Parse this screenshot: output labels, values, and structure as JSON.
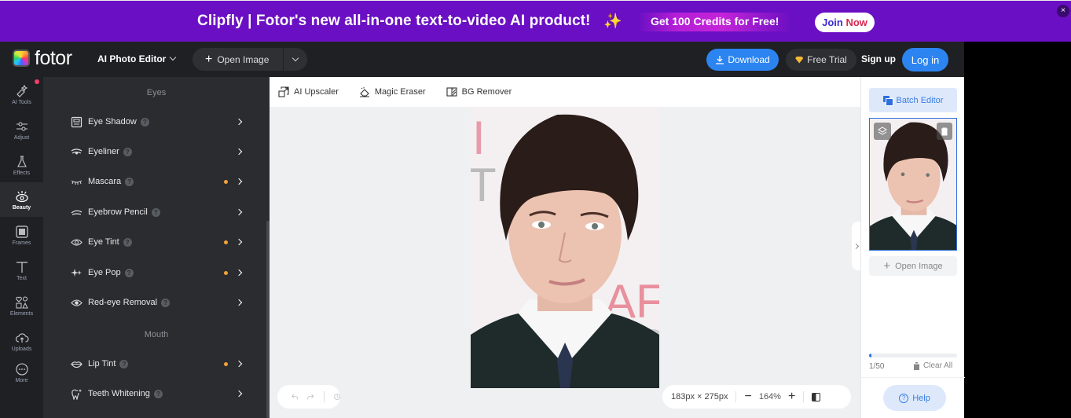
{
  "banner": {
    "title": "Clipfly | Fotor's new all-in-one text-to-video AI product!",
    "sparkle_icon": "sparkle-icon",
    "promo": "Get 100 Credits for Free!",
    "join_label_1": "Join",
    "join_label_2": "Now",
    "close_glyph": "×"
  },
  "topbar": {
    "logo_text": "fotor",
    "editor_mode": "AI Photo Editor",
    "open_image": "Open Image",
    "download": "Download",
    "free_trial": "Free Trial",
    "sign_up": "Sign up",
    "log_in": "Log in"
  },
  "rail": {
    "items": [
      {
        "label": "AI Tools",
        "icon": "ai-tools-icon"
      },
      {
        "label": "Adjust",
        "icon": "adjust-icon"
      },
      {
        "label": "Effects",
        "icon": "effects-icon"
      },
      {
        "label": "Beauty",
        "icon": "beauty-icon",
        "active": true
      },
      {
        "label": "Frames",
        "icon": "frames-icon"
      },
      {
        "label": "Text",
        "icon": "text-icon"
      },
      {
        "label": "Elements",
        "icon": "elements-icon"
      },
      {
        "label": "Uploads",
        "icon": "uploads-icon"
      },
      {
        "label": "More",
        "icon": "more-icon"
      }
    ]
  },
  "panel": {
    "sections": [
      {
        "title": "Eyes",
        "tools": [
          {
            "label": "Eye Shadow",
            "icon": "eye-shadow-icon",
            "pro": false
          },
          {
            "label": "Eyeliner",
            "icon": "eyeliner-icon",
            "pro": false
          },
          {
            "label": "Mascara",
            "icon": "mascara-icon",
            "pro": true
          },
          {
            "label": "Eyebrow Pencil",
            "icon": "eyebrow-pencil-icon",
            "pro": false
          },
          {
            "label": "Eye Tint",
            "icon": "eye-tint-icon",
            "pro": true
          },
          {
            "label": "Eye Pop",
            "icon": "eye-pop-icon",
            "pro": true
          },
          {
            "label": "Red-eye Removal",
            "icon": "red-eye-removal-icon",
            "pro": false
          }
        ]
      },
      {
        "title": "Mouth",
        "tools": [
          {
            "label": "Lip Tint",
            "icon": "lip-tint-icon",
            "pro": true
          },
          {
            "label": "Teeth Whitening",
            "icon": "teeth-whitening-icon",
            "pro": false
          }
        ]
      }
    ]
  },
  "canvas": {
    "toolbar": [
      {
        "label": "AI Upscaler",
        "icon": "upscale-icon"
      },
      {
        "label": "Magic Eraser",
        "icon": "eraser-icon"
      },
      {
        "label": "BG Remover",
        "icon": "bg-remover-icon"
      }
    ],
    "dimensions": "183px × 275px",
    "zoom_level": "164%",
    "zoom_minus": "−",
    "zoom_plus": "+"
  },
  "right_panel": {
    "batch_editor": "Batch Editor",
    "open_image": "Open Image",
    "count": "1/50",
    "usage_fraction": 0.02,
    "clear_all": "Clear All",
    "help": "Help"
  },
  "colors": {
    "banner_bg": "#6a0fc3",
    "accent_blue": "#2c84f0",
    "pro_dot": "#f4a23a",
    "notify_dot": "#f53d6b"
  }
}
